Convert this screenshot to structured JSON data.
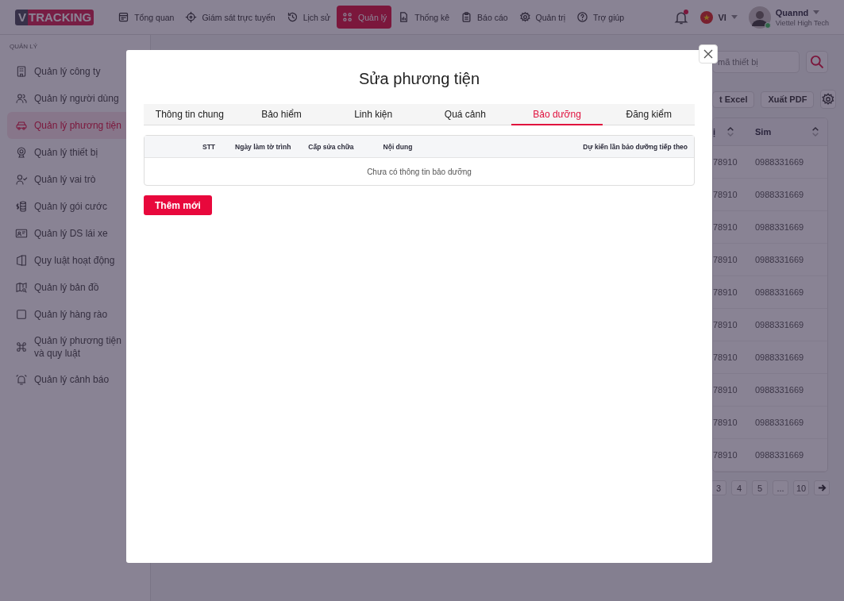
{
  "header": {
    "logo": {
      "mark": "V",
      "text": "TRACKING"
    },
    "nav": [
      {
        "label": "Tổng quan",
        "selected": false
      },
      {
        "label": "Giám sát trực tuyến",
        "selected": false
      },
      {
        "label": "Lịch sử",
        "selected": false
      },
      {
        "label": "Quản lý",
        "selected": true
      },
      {
        "label": "Thống kê",
        "selected": false
      },
      {
        "label": "Báo cáo",
        "selected": false
      },
      {
        "label": "Quản trị",
        "selected": false
      },
      {
        "label": "Trợ giúp",
        "selected": false
      }
    ],
    "notifications": {
      "unread": true
    },
    "language": {
      "code": "VI"
    },
    "user": {
      "name": "Quannd",
      "org": "Viettel High Tech",
      "online": true
    }
  },
  "sidebar": {
    "section": "QUẢN LÝ",
    "items": [
      {
        "label": "Quản lý công ty",
        "selected": false
      },
      {
        "label": "Quản lý người dùng",
        "selected": false
      },
      {
        "label": "Quản lý phương tiện",
        "selected": true
      },
      {
        "label": "Quản lý thiết bị",
        "selected": false
      },
      {
        "label": "Quản lý vai trò",
        "selected": false
      },
      {
        "label": "Quản lý gói cước",
        "selected": false
      },
      {
        "label": "Quản lý DS lái xe",
        "selected": false
      },
      {
        "label": "Quy luật hoạt động",
        "selected": false
      },
      {
        "label": "Quản lý bản đồ",
        "selected": false
      },
      {
        "label": "Quản lý hàng rào",
        "selected": false
      },
      {
        "label": "Quản lý phương tiện và quy luật",
        "selected": false
      },
      {
        "label": "Quản lý cảnh báo",
        "selected": false
      }
    ]
  },
  "background": {
    "search": {
      "placeholder": "mã thiết bị"
    },
    "buttons": [
      "t Excel",
      "Xuất PDF"
    ],
    "columns": [
      "ị",
      "Sim"
    ],
    "rows": [
      {
        "column_1": "78910",
        "sim": "0988331669"
      },
      {
        "column_1": "78910",
        "sim": "0988331669"
      },
      {
        "column_1": "78910",
        "sim": "0988331669"
      },
      {
        "column_1": "78910",
        "sim": "0988331669"
      },
      {
        "column_1": "78910",
        "sim": "0988331669"
      },
      {
        "column_1": "78910",
        "sim": "0988331669"
      },
      {
        "column_1": "78910",
        "sim": "0988331669"
      },
      {
        "column_1": "78910",
        "sim": "0988331669"
      },
      {
        "column_1": "78910",
        "sim": "0988331669"
      },
      {
        "column_1": "78910",
        "sim": "0988331669"
      }
    ],
    "pagination": [
      "3",
      "4",
      "5",
      "...",
      "10"
    ]
  },
  "modal": {
    "title": "Sửa phương tiện",
    "tabs": [
      {
        "label": "Thông tin chung",
        "selected": false
      },
      {
        "label": "Bảo hiểm",
        "selected": false
      },
      {
        "label": "Linh kiện",
        "selected": false
      },
      {
        "label": "Quá cảnh",
        "selected": false
      },
      {
        "label": "Bảo dưỡng",
        "selected": true
      },
      {
        "label": "Đăng kiểm",
        "selected": false
      }
    ],
    "table": {
      "columns": [
        "STT",
        "Ngày làm tờ trình",
        "Cấp sửa chữa",
        "Nội dung",
        "Dự kiến lần bảo dưỡng tiếp theo"
      ],
      "empty_message": "Chưa có thông tin bảo dưỡng"
    },
    "add_button": "Thêm mới"
  }
}
